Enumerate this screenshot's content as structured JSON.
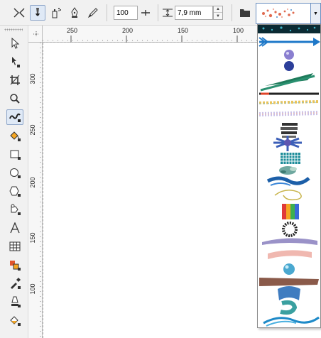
{
  "property_bar": {
    "mode_buttons": [
      {
        "name": "preset",
        "icon": "preset-artistic-media-icon"
      },
      {
        "name": "brush",
        "icon": "brush-mode-icon"
      },
      {
        "name": "sprayer",
        "icon": "sprayer-mode-icon"
      },
      {
        "name": "calligraphic",
        "icon": "calligraphic-pen-icon"
      },
      {
        "name": "expression",
        "icon": "expression-pen-icon"
      }
    ],
    "freehand_smoothing": "100",
    "stroke_width": "7,9 mm",
    "active_mode": "preset"
  },
  "toolbox": {
    "tools": [
      {
        "name": "pick-tool",
        "icon": "arrow-cursor-icon"
      },
      {
        "name": "shape-tool",
        "icon": "shape-edit-icon"
      },
      {
        "name": "crop-tool",
        "icon": "crop-icon"
      },
      {
        "name": "zoom-tool",
        "icon": "magnifier-icon"
      },
      {
        "name": "artistic-media-tool",
        "icon": "artistic-media-icon",
        "active": true
      },
      {
        "name": "smart-fill-tool",
        "icon": "smart-fill-icon"
      },
      {
        "name": "rectangle-tool",
        "icon": "rectangle-icon"
      },
      {
        "name": "ellipse-tool",
        "icon": "ellipse-icon"
      },
      {
        "name": "polygon-tool",
        "icon": "polygon-icon"
      },
      {
        "name": "basic-shapes-tool",
        "icon": "basic-shapes-icon"
      },
      {
        "name": "text-tool",
        "icon": "text-a-icon"
      },
      {
        "name": "table-tool",
        "icon": "table-icon"
      },
      {
        "name": "parallel-dimension-tool",
        "icon": "dimension-icon"
      },
      {
        "name": "eyedropper-tool",
        "icon": "eyedropper-icon"
      },
      {
        "name": "outline-pen-tool",
        "icon": "outline-pen-icon"
      },
      {
        "name": "fill-tool",
        "icon": "bucket-fill-icon"
      }
    ]
  },
  "ruler": {
    "top_labels": [
      "250",
      "200",
      "150",
      "100"
    ],
    "left_labels": [
      "300",
      "250",
      "200",
      "150",
      "100"
    ]
  },
  "presets": {
    "strokes": [
      "teal-splatter",
      "blue-arrow",
      "purple-spheres",
      "green-streak",
      "black-red-line",
      "confetti-line",
      "pastel-dots",
      "stacked-bars",
      "blue-star-burst",
      "teal-pixel-grid",
      "teal-leaves",
      "blue-wave",
      "yellow-swirl",
      "rainbow-column",
      "dotted-ring",
      "lilac-blur",
      "pink-blur",
      "blue-bead",
      "brown-smear",
      "blue-ribbon",
      "teal-curl",
      "blue-splash"
    ],
    "colors": {
      "teal": "#1d8c9a",
      "blue": "#1c5fa8",
      "purple": "#5e56b0",
      "brown": "#8a5a4a",
      "accent": "#6b8fc0"
    }
  }
}
